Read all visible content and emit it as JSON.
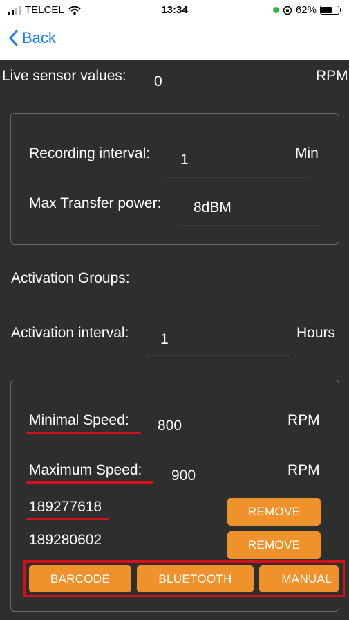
{
  "status_bar": {
    "carrier": "TELCEL",
    "time": "13:34",
    "battery": "62%",
    "battery_level": 0.62
  },
  "nav": {
    "back_label": "Back"
  },
  "live_sensor": {
    "label": "Live sensor values:",
    "value": "0",
    "unit": "RPM"
  },
  "recording": {
    "interval_label": "Recording interval:",
    "interval_value": "1",
    "interval_unit": "Min",
    "power_label": "Max Transfer power:",
    "power_value": "8dBM"
  },
  "activation": {
    "groups_label": "Activation Groups:",
    "interval_label": "Activation interval:",
    "interval_value": "1",
    "interval_unit": "Hours"
  },
  "group": {
    "min_label": "Minimal Speed:",
    "min_value": "800",
    "min_unit": "RPM",
    "max_label": "Maximum Speed:",
    "max_value": "900",
    "max_unit": "RPM",
    "devices": [
      {
        "id": "189277618",
        "remove_label": "REMOVE"
      },
      {
        "id": "189280602",
        "remove_label": "REMOVE"
      }
    ],
    "add_buttons": {
      "barcode": "BARCODE",
      "bluetooth": "BLUETOOTH",
      "manual": "MANUAL"
    }
  },
  "colors": {
    "background": "#2e2e2e",
    "accent": "#f0922c",
    "link": "#1a7df5",
    "annotation": "#d4101a"
  }
}
